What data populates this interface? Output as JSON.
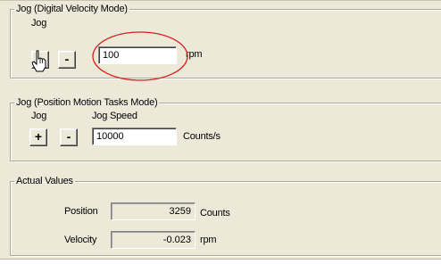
{
  "jog_velocity": {
    "legend": "Jog (Digital Velocity Mode)",
    "jog_label": "Jog",
    "minus_label": "-",
    "value": "100",
    "unit": "rpm"
  },
  "jog_position": {
    "legend": "Jog (Position Motion Tasks Mode)",
    "jog_label": "Jog",
    "speed_label": "Jog Speed",
    "plus_label": "+",
    "minus_label": "-",
    "value": "10000",
    "unit": "Counts/s"
  },
  "actual_values": {
    "legend": "Actual Values",
    "position_label": "Position",
    "position_value": "3259",
    "position_unit": "Counts",
    "velocity_label": "Velocity",
    "velocity_value": "-0.023",
    "velocity_unit": "rpm"
  },
  "colors": {
    "panel": "#ece9d8",
    "highlight_ring": "#d42020"
  },
  "icons": {
    "jog_plus_button_icon": "hand-pointer-cursor-icon"
  }
}
